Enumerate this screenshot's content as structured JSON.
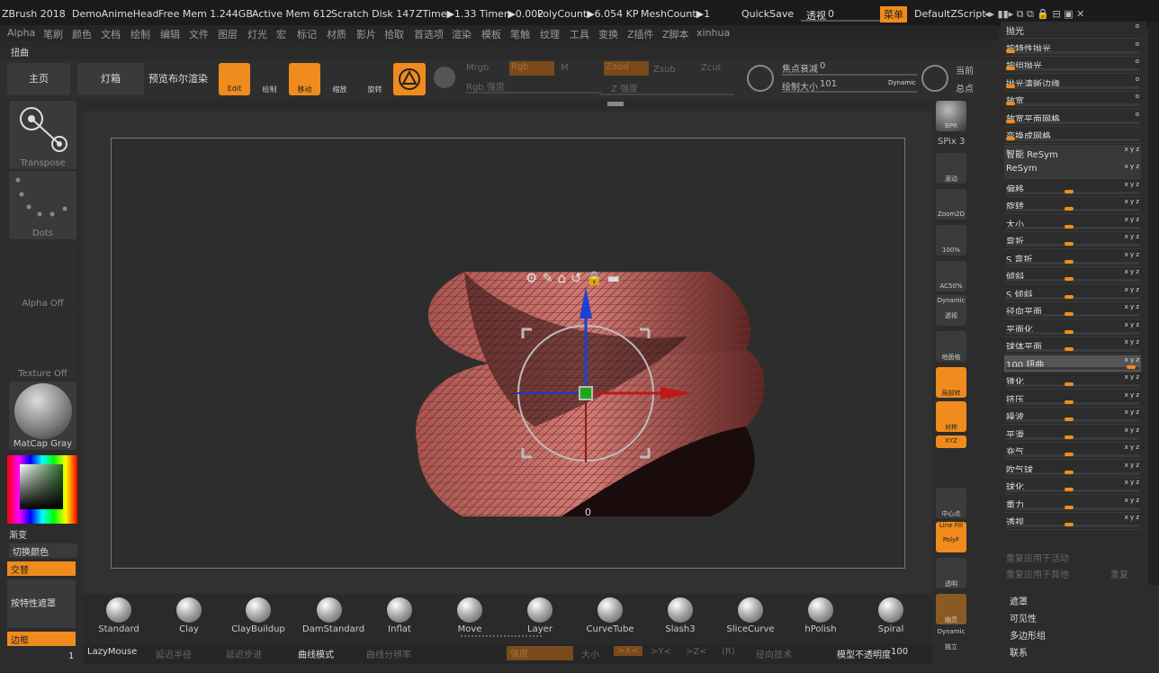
{
  "titlebar": {
    "app": "ZBrush 2018",
    "doc": "DemoAnimeHead",
    "freemem": "Free Mem 1.244GB",
    "activemem": "Active Mem 612",
    "scratch": "Scratch Disk 147",
    "ztime": "ZTime▶1.33 Timer▶0.002",
    "polycount": "PolyCount▶6.054 KP",
    "meshcount": "MeshCount▶1",
    "quicksave": "QuickSave",
    "transp_label": "透视",
    "transp_value": "0",
    "menu": "菜单",
    "script": "DefaultZScript"
  },
  "menubar": {
    "items": [
      "Alpha",
      "笔刷",
      "颜色",
      "文档",
      "绘制",
      "编辑",
      "文件",
      "图层",
      "灯光",
      "宏",
      "标记",
      "材质",
      "影片",
      "拾取",
      "首选项",
      "渲染",
      "模板",
      "笔触",
      "纹理",
      "工具",
      "变换",
      "Z插件",
      "Z脚本",
      "xinhua"
    ]
  },
  "subbar": {
    "label": "扭曲"
  },
  "toolbar": {
    "home": "主页",
    "lightbox": "灯箱",
    "bpr": "预览布尔渲染",
    "edit": "Edit",
    "draw": "绘制",
    "move": "移动",
    "scale": "缩放",
    "rotate": "旋转",
    "mrgb": "Mrgb",
    "rgb": "Rgb",
    "m": "M",
    "rgb_int": "Rgb 强度",
    "zadd": "Zadd",
    "zsub": "Zsub",
    "zcut": "Zcut",
    "z_int": "Z 强度",
    "focal_label": "焦点衰减",
    "focal_value": "0",
    "drawsize_label": "绘制大小",
    "drawsize_value": "101",
    "dynamic": "Dynamic",
    "current": "当前",
    "total": "总点"
  },
  "leftshelf": {
    "transpose": "Transpose",
    "dots": "Dots",
    "alpha": "Alpha Off",
    "texture": "Texture Off",
    "material": "MatCap Gray",
    "gradient": "渐变",
    "switch_color": "切换颜色",
    "alternate": "交替",
    "mask_by": "按特性遮罩",
    "border": "边框",
    "count": "1"
  },
  "viewport": {
    "gizmo_value": "0"
  },
  "rightshelf": {
    "bpr": "BPR",
    "spix_label": "SPix",
    "spix_value": "3",
    "scroll": "滚动",
    "zoom2d": "Zoom2D",
    "pct100": "100%",
    "ac50": "AC50%",
    "persp_dyn": "Dynamic",
    "persp": "透视",
    "floor": "地面格",
    "localsym": "局部转",
    "sym": "对称",
    "xyz": "XYZ",
    "center": "中心点",
    "linefill": "Line Fill",
    "polyf": "PolyF",
    "transp": "透明",
    "ghost": "幽灵",
    "dyn2": "Dynamic",
    "solo": "独立"
  },
  "panel": {
    "rows": [
      {
        "label": "抛光",
        "slider": false,
        "icon": "o"
      },
      {
        "label": "按特性抛光",
        "slider": true,
        "kpos": 0,
        "icon": "o"
      },
      {
        "label": "按组抛光",
        "slider": true,
        "kpos": 0,
        "icon": "o"
      },
      {
        "label": "抛光清晰边缘",
        "slider": true,
        "kpos": 0,
        "icon": "o"
      },
      {
        "label": "放宽",
        "slider": true,
        "kpos": 0,
        "icon": "o"
      },
      {
        "label": "放宽平面网格",
        "slider": true,
        "kpos": 0,
        "icon": "o"
      },
      {
        "label": "变换成网格",
        "slider": true,
        "kpos": 0,
        "icon": ""
      },
      {
        "label": "智能 ReSym",
        "slider": false,
        "icon": "x y z"
      },
      {
        "label": "ReSym",
        "slider": false,
        "icon": "x y z"
      },
      {
        "label": "偏移",
        "slider": true,
        "kpos": 0.47,
        "icon": "x y z"
      },
      {
        "label": "旋转",
        "slider": true,
        "kpos": 0.47,
        "icon": "x y z"
      },
      {
        "label": "大小",
        "slider": true,
        "kpos": 0.47,
        "icon": "x y z"
      },
      {
        "label": "弯折",
        "slider": true,
        "kpos": 0.47,
        "icon": "x y z"
      },
      {
        "label": "S 弯折",
        "slider": true,
        "kpos": 0.47,
        "icon": "x y z"
      },
      {
        "label": "倾斜",
        "slider": true,
        "kpos": 0.47,
        "icon": "x y z"
      },
      {
        "label": "S 倾斜",
        "slider": true,
        "kpos": 0.47,
        "icon": "x y z"
      },
      {
        "label": "径向平面",
        "slider": true,
        "kpos": 0.47,
        "icon": "x y z"
      },
      {
        "label": "平面化",
        "slider": true,
        "kpos": 0.47,
        "icon": "x y z"
      },
      {
        "label": "球体平面",
        "slider": true,
        "kpos": 0.47,
        "icon": "x y z"
      },
      {
        "label": "100 扭曲",
        "slider": true,
        "kpos": 0.97,
        "icon": "x y z",
        "active": true
      },
      {
        "label": "锥化",
        "slider": true,
        "kpos": 0.47,
        "icon": "x y z"
      },
      {
        "label": "挤压",
        "slider": true,
        "kpos": 0.47,
        "icon": "x y z"
      },
      {
        "label": "噪波",
        "slider": true,
        "kpos": 0.47,
        "icon": "x y z"
      },
      {
        "label": "平滑",
        "slider": true,
        "kpos": 0.47,
        "icon": "x y z"
      },
      {
        "label": "充气",
        "slider": true,
        "kpos": 0.47,
        "icon": "x y z"
      },
      {
        "label": "吹气球",
        "slider": true,
        "kpos": 0.47,
        "icon": "x y z"
      },
      {
        "label": "球化",
        "slider": true,
        "kpos": 0.47,
        "icon": "x y z"
      },
      {
        "label": "重力",
        "slider": true,
        "kpos": 0.47,
        "icon": "x y z"
      },
      {
        "label": "透视",
        "slider": true,
        "kpos": 0.47,
        "icon": "x y z"
      }
    ],
    "repeat_active": "重复应用于活动",
    "repeat_other": "重复应用于其他",
    "repeat": "重复"
  },
  "rmenu": {
    "items": [
      "遮罩",
      "可见性",
      "多边形组",
      "联系"
    ]
  },
  "brushes": [
    "Standard",
    "Clay",
    "ClayBuildup",
    "DamStandard",
    "Inflat",
    "Move",
    "Layer",
    "CurveTube",
    "Slash3",
    "SliceCurve",
    "hPolish",
    "Spiral"
  ],
  "statusbar": {
    "lazymouse": "LazyMouse",
    "lazyradius": "延迟半径",
    "lazystep": "延迟步进",
    "curvemode": "曲线模式",
    "curveres": "曲线分辨率",
    "intensity": "强度",
    "size": "大小",
    "x": ">X<",
    "y": ">Y<",
    "z": ">Z<",
    "r": "(R)",
    "radial": "径向技术",
    "opacity_label": "模型不透明度",
    "opacity_value": "100"
  },
  "colors": {
    "accent": "#f08b1e",
    "mesh": "#c56b66"
  }
}
